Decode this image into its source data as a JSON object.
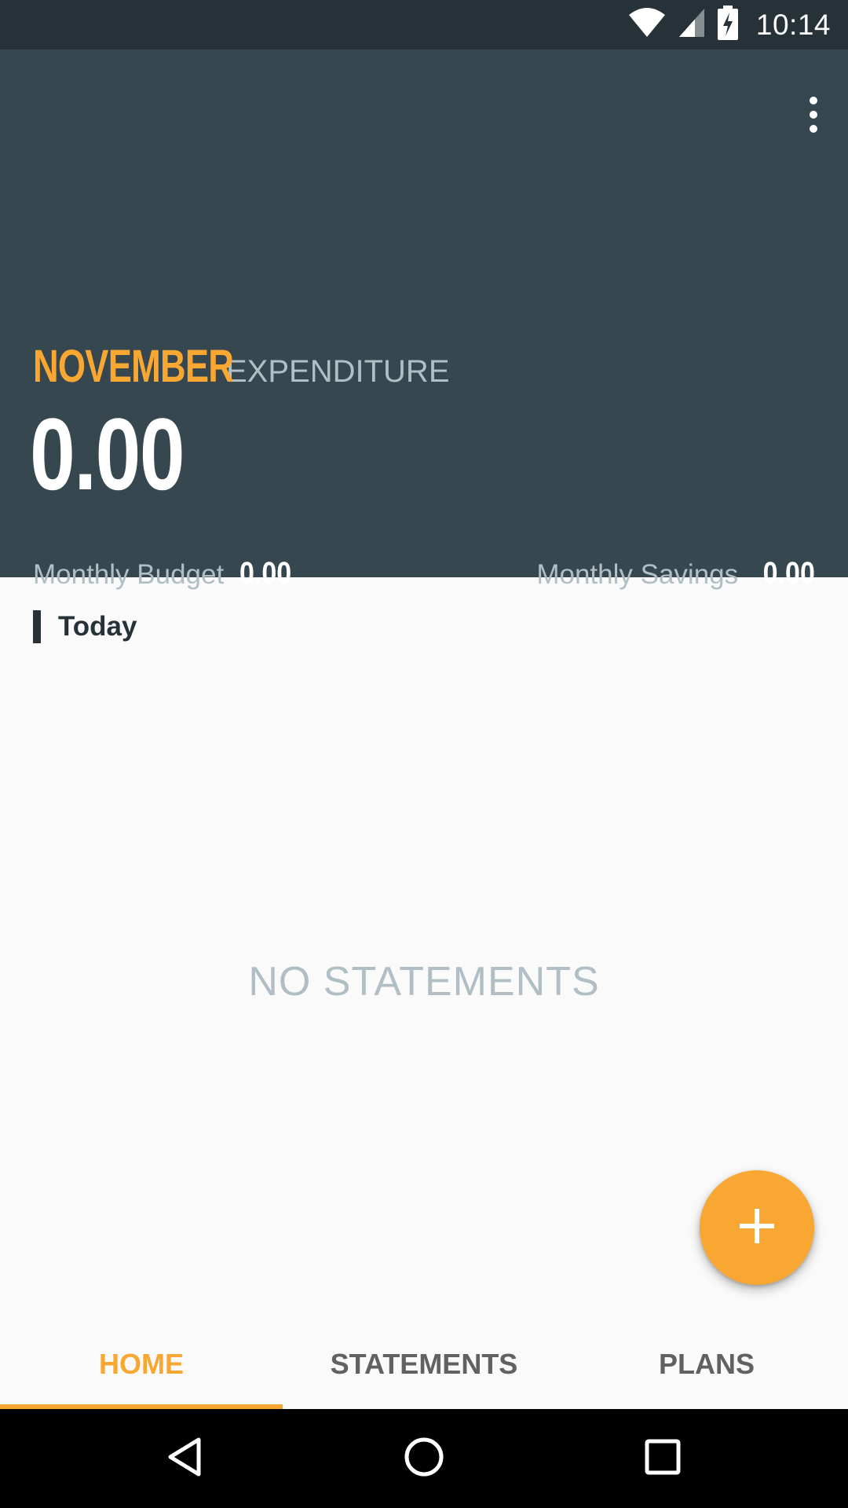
{
  "status_bar": {
    "time": "10:14",
    "icons": [
      "wifi-icon",
      "cell-signal-icon",
      "battery-charging-icon"
    ]
  },
  "header": {
    "month": "NOVEMBER",
    "label": "EXPENDITURE",
    "amount": "0.00",
    "budget_label": "Monthly Budget",
    "budget_value": "0.00",
    "savings_label": "Monthly Savings",
    "savings_value": "0.00",
    "menu_icon": "more-vert-icon"
  },
  "content": {
    "section_title": "Today",
    "empty_message": "NO STATEMENTS"
  },
  "fab": {
    "icon": "plus-icon"
  },
  "tabs": [
    {
      "label": "HOME",
      "active": true
    },
    {
      "label": "STATEMENTS",
      "active": false
    },
    {
      "label": "PLANS",
      "active": false
    }
  ],
  "nav_bar": {
    "icons": [
      "back-icon",
      "home-icon",
      "recents-icon"
    ]
  },
  "colors": {
    "accent": "#f9a733",
    "header_bg": "#37474f",
    "status_bg": "#263238",
    "muted_text": "#b0bec5"
  }
}
